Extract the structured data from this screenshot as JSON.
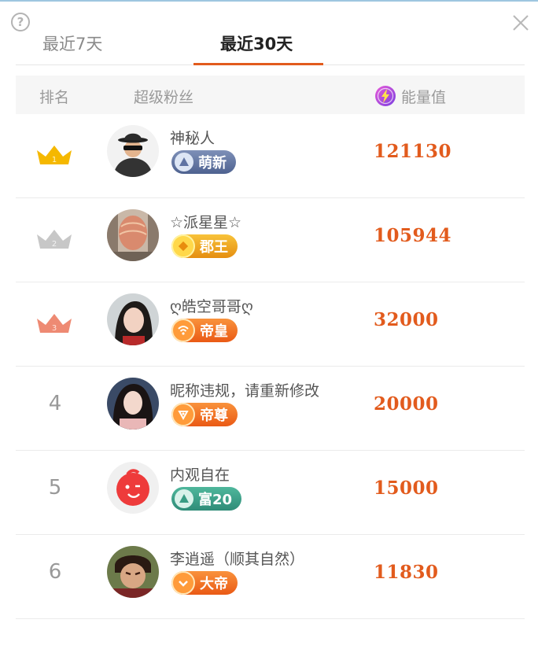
{
  "tabs": [
    {
      "label": "最近7天",
      "active": false
    },
    {
      "label": "最近30天",
      "active": true
    }
  ],
  "header": {
    "rank": "排名",
    "fan": "超级粉丝",
    "energy": "能量值"
  },
  "colors": {
    "accent": "#e25b1d",
    "energy_value": "#e25b1d",
    "crown_gold": "#f5b800",
    "crown_silver": "#c7c7c7",
    "crown_bronze": "#ee8a73"
  },
  "icons": {
    "help": "question-circle-icon",
    "close": "close-icon",
    "energy": "lightning-icon"
  },
  "rows": [
    {
      "rank": "1",
      "rank_display": "gold-crown-icon",
      "name": "神秘人",
      "badge": "萌新",
      "energy": "121130"
    },
    {
      "rank": "2",
      "rank_display": "silver-crown-icon",
      "name": "☆派星星☆",
      "badge": "郡王",
      "energy": "105944"
    },
    {
      "rank": "3",
      "rank_display": "bronze-crown-icon",
      "name": "ღ皓空哥哥ღ",
      "badge": "帝皇",
      "energy": "32000"
    },
    {
      "rank": "4",
      "name": "昵称违规，请重新修改",
      "badge": "帝尊",
      "energy": "20000"
    },
    {
      "rank": "5",
      "name": "内观自在",
      "badge": "富20",
      "energy": "15000"
    },
    {
      "rank": "6",
      "name": "李逍遥（顺其自然）",
      "badge": "大帝",
      "energy": "11830"
    }
  ]
}
